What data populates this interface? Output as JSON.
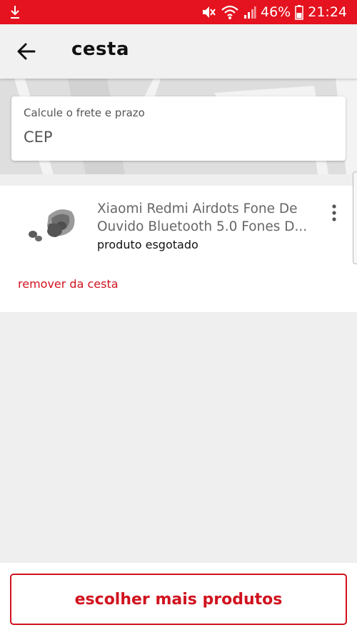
{
  "status_bar": {
    "battery": "46%",
    "time": "21:24",
    "icons": [
      "download-icon",
      "mute-icon",
      "wifi-icon",
      "signal-icon",
      "battery-icon"
    ]
  },
  "header": {
    "title": "cesta",
    "back_icon": "arrow-left-icon"
  },
  "shipping": {
    "label": "Calcule o frete e prazo",
    "placeholder": "CEP"
  },
  "cart": {
    "items": [
      {
        "name_line1": "Xiaomi Redmi Airdots Fone De",
        "name_line2": "Ouvido Bluetooth 5.0 Fones D...",
        "status": "produto esgotado",
        "remove_label": "remover da cesta",
        "menu_icon": "more-vertical-icon"
      }
    ]
  },
  "footer": {
    "cta_label": "escolher mais produtos"
  },
  "colors": {
    "brand": "#e4131f",
    "accent_text": "#d0121e",
    "background": "#efefef"
  }
}
